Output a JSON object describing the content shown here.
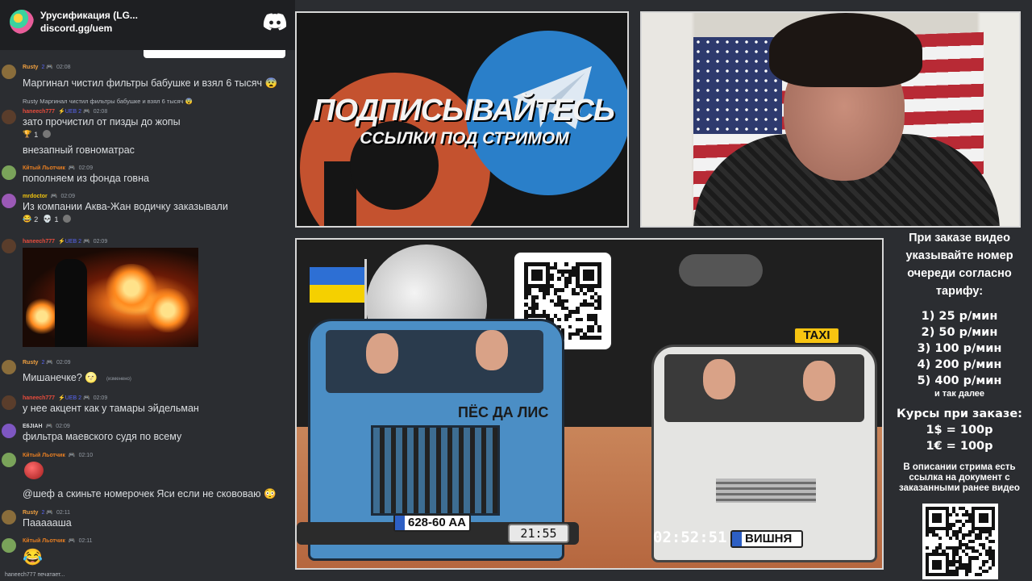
{
  "server": {
    "name": "Урусификация (LG...",
    "invite": "discord.gg/uem"
  },
  "chat": {
    "messages": [
      {
        "user": "Rusty",
        "color": "#f0a040",
        "badge": "2 🎮",
        "time": "02:08",
        "text": "Маргинал чистил фильтры бабушке и взял 6 тысяч 😨"
      },
      {
        "reply_to": "Rusty Маргинал чистил фильтры бабушке и взял 6 тысяч 😨",
        "user": "haneech777",
        "color": "#e74c3c",
        "badge": "⚡UEB 2 🎮",
        "time": "02:08",
        "text": "зато прочистил от пизды до жопы",
        "reactions": [
          {
            "emoji": "🏆",
            "count": "1"
          }
        ]
      },
      {
        "text": "внезапный говноматрас"
      },
      {
        "user": "Кйтый Льотчик",
        "color": "#e67e22",
        "badge": "🎮",
        "time": "02:09",
        "text": "пополняем из фонда говна"
      },
      {
        "user": "mrdoctor",
        "color": "#f1c40f",
        "badge": "🎮",
        "time": "02:09",
        "text": "Из компании Аква-Жан водичку заказывали",
        "reactions": [
          {
            "emoji": "😂",
            "count": "2"
          },
          {
            "emoji": "💀",
            "count": "1"
          }
        ]
      },
      {
        "user": "haneech777",
        "color": "#e74c3c",
        "badge": "⚡UEB 2 🎮",
        "time": "02:09"
      },
      {
        "user": "Rusty",
        "color": "#f0a040",
        "badge": "2 🎮",
        "time": "02:09",
        "text": "Мишанечке? 🌝",
        "edited": "(изменено)"
      },
      {
        "user": "haneech777",
        "color": "#e74c3c",
        "badge": "⚡UEB 2 🎮",
        "time": "02:09",
        "text": "у нее акцент как у тамары эйдельман"
      },
      {
        "user": "E6JIAH",
        "color": "#dbdee1",
        "badge": "🎮",
        "time": "02:09",
        "text": "фильтра маевского судя по всему"
      },
      {
        "user": "Кйтый Льотчик",
        "color": "#e67e22",
        "badge": "🎮",
        "time": "02:10",
        "text": "@шеф а скиньте номерочек Яси если не скововаю 😳"
      },
      {
        "user": "Rusty",
        "color": "#f0a040",
        "badge": "2 🎮",
        "time": "02:11",
        "text": "Паааааша"
      },
      {
        "user": "Кйтый Льотчик",
        "color": "#e67e22",
        "badge": "🎮",
        "time": "02:11",
        "text": "😂"
      }
    ],
    "typing": "haneech777 печатает..."
  },
  "promo": {
    "title": "ПОДПИСЫВАЙТЕСЬ",
    "subtitle": "ССЫЛКИ ПОД СТРИМОМ"
  },
  "scene": {
    "truck_label": "ПЁС ДА ЛИС",
    "truck_plate": "628-60 AA",
    "clock": "21:55",
    "uptime": "02:52:51",
    "van_plate": "ВИШНЯ",
    "taxi_sign": "TAXI"
  },
  "info": {
    "order_text": "При заказе видео указывайте номер очереди согласно тарифу:",
    "tariffs": [
      "1) 25 р/мин",
      "2) 50 р/мин",
      "3) 100 р/мин",
      "4) 200 р/мин",
      "5) 400 р/мин"
    ],
    "etc": "и так далее",
    "rates_title": "Курсы при заказе:",
    "rates": [
      "1$ = 100р",
      "1€ = 100р"
    ],
    "doc_text": "В описании стрима есть ссылка на документ с заказанными ранее видео"
  },
  "colors": {
    "discord_bg": "#2b2d31",
    "accent": "#5865f2",
    "telegram_blue": "#2a7fc9",
    "patreon_orange": "#c4522f"
  }
}
